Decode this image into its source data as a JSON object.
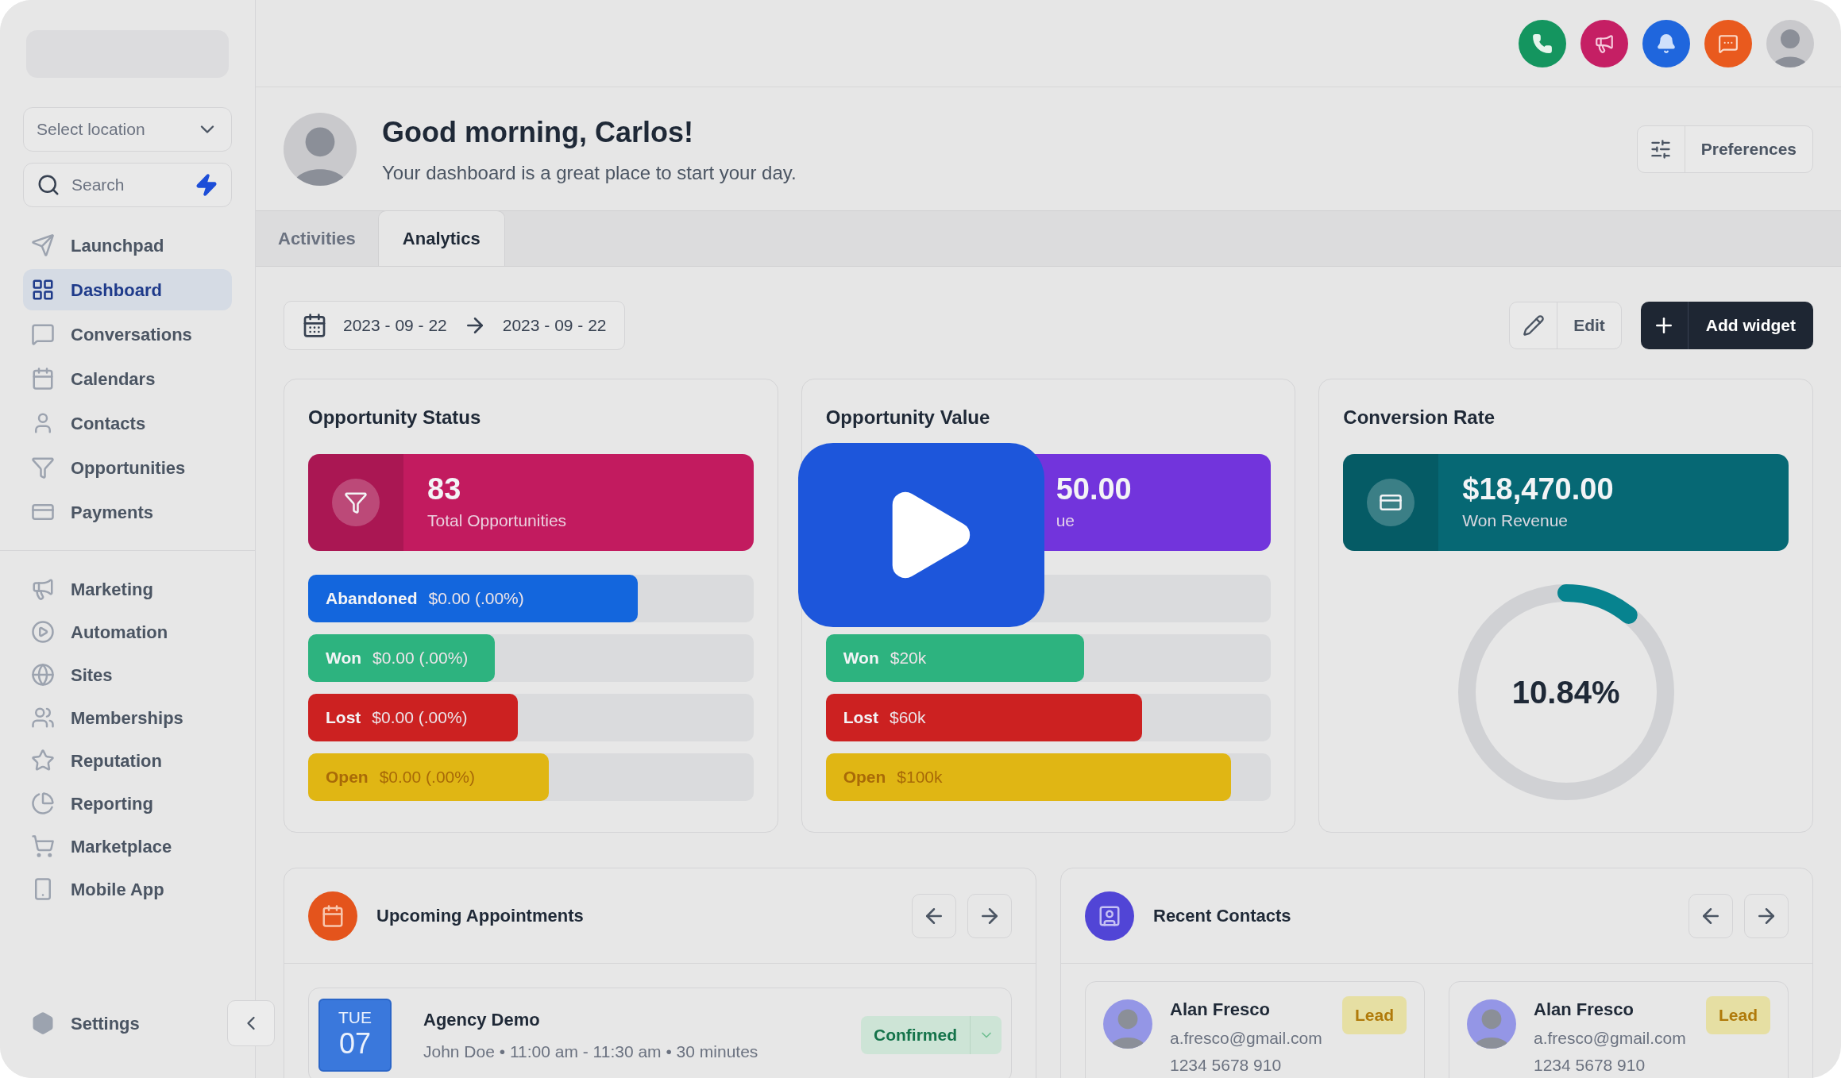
{
  "sidebar": {
    "location_select": {
      "placeholder": "Select location"
    },
    "search": {
      "placeholder": "Search"
    },
    "nav_items": [
      {
        "label": "Launchpad",
        "selected": false
      },
      {
        "label": "Dashboard",
        "selected": true
      },
      {
        "label": "Conversations",
        "selected": false
      },
      {
        "label": "Calendars",
        "selected": false
      },
      {
        "label": "Contacts",
        "selected": false
      },
      {
        "label": "Opportunities",
        "selected": false
      },
      {
        "label": "Payments",
        "selected": false
      }
    ],
    "secondary_items": [
      {
        "label": "Marketing",
        "selected": false
      },
      {
        "label": "Automation",
        "selected": false
      },
      {
        "label": "Sites",
        "selected": false
      },
      {
        "label": "Memberships",
        "selected": false
      },
      {
        "label": "Reputation",
        "selected": false
      },
      {
        "label": "Reporting",
        "selected": false
      },
      {
        "label": "Marketplace",
        "selected": false
      },
      {
        "label": "Mobile App",
        "selected": false
      }
    ],
    "settings": "Settings"
  },
  "header": {
    "greeting": "Good morning, Carlos!",
    "subtitle": "Your dashboard is a great place to start your day.",
    "preferences": "Preferences"
  },
  "tabs": [
    {
      "label": "Activities",
      "selected": false
    },
    {
      "label": "Analytics",
      "selected": true
    }
  ],
  "date_range": {
    "start": "2023 - 09 - 22",
    "end": "2023 - 09 - 22"
  },
  "actions": {
    "edit": "Edit",
    "add_widget": "Add widget"
  },
  "opportunity_status": {
    "title": "Opportunity Status",
    "stat_value": "83",
    "stat_label": "Total Opportunities",
    "color": "#c21b5f",
    "bars": [
      {
        "label": "Abandoned",
        "value": "$0.00 (.00%)",
        "level": 0.74,
        "color": "#1366dd"
      },
      {
        "label": "Won",
        "value": "$0.00 (.00%)",
        "level": 0.42,
        "color": "#2db37f"
      },
      {
        "label": "Lost",
        "value": "$0.00 (.00%)",
        "level": 0.47,
        "color": "#cc2121"
      },
      {
        "label": "Open",
        "value": "$0.00 (.00%)",
        "level": 0.54,
        "color": "#e0b614"
      }
    ]
  },
  "opportunity_value": {
    "title": "Opportunity Value",
    "stat_value": "50.00",
    "stat_label": "ue",
    "color": "#7234dc",
    "bars": [
      {
        "label": "Won",
        "value": "$20k",
        "level": 0.58,
        "color": "#2db37f"
      },
      {
        "label": "Lost",
        "value": "$60k",
        "level": 0.71,
        "color": "#cc2121"
      },
      {
        "label": "Open",
        "value": "$100k",
        "level": 0.91,
        "color": "#e0b614"
      }
    ]
  },
  "conversion_rate": {
    "title": "Conversion Rate",
    "stat_value": "$18,470.00",
    "stat_label": "Won Revenue",
    "color": "#066874",
    "level": 0.1084,
    "reading": "10.84%"
  },
  "appointments": {
    "title": "Upcoming Appointments",
    "items": [
      {
        "weekday": "TUE",
        "day": "07",
        "title": "Agency Demo",
        "details": "John Doe • 11:00 am - 11:30 am • 30 minutes",
        "status": "Confirmed"
      }
    ]
  },
  "recent_contacts": {
    "title": "Recent Contacts",
    "items": [
      {
        "name": "Alan Fresco",
        "email": "a.fresco@gmail.com",
        "phone": "1234 5678 910",
        "tag": "Lead"
      },
      {
        "name": "Alan Fresco",
        "email": "a.fresco@gmail.com",
        "phone": "1234 5678 910",
        "tag": "Lead"
      }
    ]
  }
}
